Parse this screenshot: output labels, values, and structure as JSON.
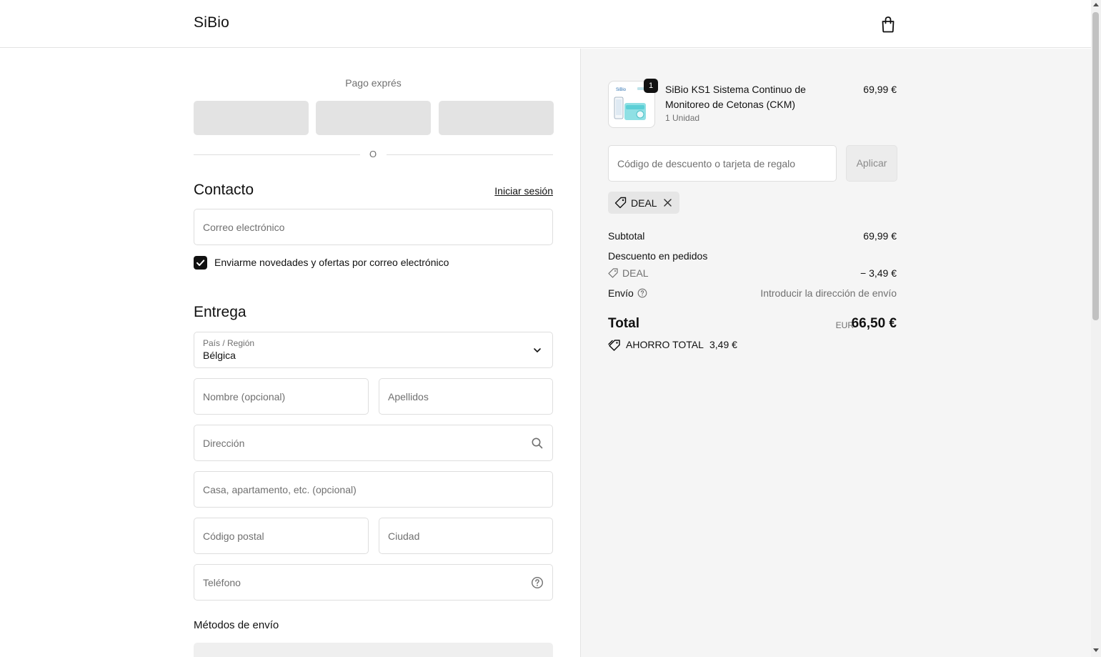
{
  "header": {
    "brand": "SiBio",
    "cart_icon": "shopping-bag-icon"
  },
  "express": {
    "title": "Pago exprés",
    "divider_text": "O"
  },
  "contact": {
    "title": "Contacto",
    "login_link": "Iniciar sesión",
    "email_placeholder": "Correo electrónico",
    "newsletter_label": "Enviarme novedades y ofertas por correo electrónico",
    "newsletter_checked": true
  },
  "delivery": {
    "title": "Entrega",
    "country_label": "País / Región",
    "country_value": "Bélgica",
    "first_name_placeholder": "Nombre (opcional)",
    "last_name_placeholder": "Apellidos",
    "address_placeholder": "Dirección",
    "apartment_placeholder": "Casa, apartamento, etc. (opcional)",
    "postal_placeholder": "Código postal",
    "city_placeholder": "Ciudad",
    "phone_placeholder": "Teléfono"
  },
  "shipping_methods": {
    "title": "Métodos de envío"
  },
  "summary": {
    "product": {
      "name": "SiBio KS1 Sistema Continuo de Monitoreo de Cetonas (CKM)",
      "quantity_badge": "1",
      "unit": "1 Unidad",
      "price": "69,99 €",
      "thumb_brand": "SiBio"
    },
    "discount_placeholder": "Código de descuento o tarjeta de regalo",
    "apply_label": "Aplicar",
    "applied_code": "DEAL",
    "subtotal_label": "Subtotal",
    "subtotal_value": "69,99 €",
    "order_discount_label": "Descuento en pedidos",
    "discount_code": "DEAL",
    "discount_value": "− 3,49 €",
    "shipping_label": "Envío",
    "shipping_value": "Introducir la dirección de envío",
    "total_label": "Total",
    "currency": "EUR",
    "total_value": "66,50 €",
    "savings_label": "AHORRO TOTAL",
    "savings_value": "3,49 €"
  },
  "colors": {
    "text": "#1a1a1a",
    "muted": "#707070",
    "border": "#dedede",
    "summary_bg": "#f5f5f5",
    "accent": "#111111"
  }
}
